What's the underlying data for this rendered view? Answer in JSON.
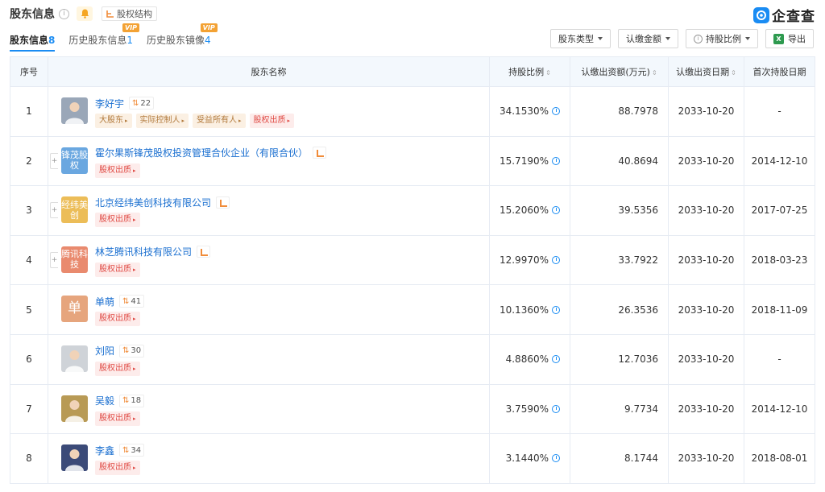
{
  "header": {
    "title": "股东信息",
    "info_glyph": "i",
    "structure_btn": "股权结构",
    "brand": "企查查"
  },
  "tabs": [
    {
      "label": "股东信息",
      "count": "8",
      "vip": ""
    },
    {
      "label": "历史股东信息",
      "count": "1",
      "vip": "VIP"
    },
    {
      "label": "历史股东镜像",
      "count": "4",
      "vip": "VIP"
    }
  ],
  "filters": {
    "type": "股东类型",
    "amount": "认缴金额",
    "ratio": "持股比例",
    "export": "导出",
    "info_glyph": "i",
    "excel_glyph": "X"
  },
  "columns": {
    "idx": "序号",
    "name": "股东名称",
    "ratio": "持股比例",
    "capital": "认缴出资额(万元)",
    "date": "认缴出资日期",
    "first_date": "首次持股日期",
    "sort_glyph": "⇕"
  },
  "glyphs": {
    "expand": "+",
    "related": "⇅",
    "tag_arrow": "▸"
  },
  "rows": [
    {
      "idx": "1",
      "name": "李好宇",
      "avatar_text": "",
      "avatar_color": "#9aa7b8",
      "count": "22",
      "tags": [
        [
          "大股东",
          "brown"
        ],
        [
          "实际控制人",
          "brown"
        ],
        [
          "受益所有人",
          "brown"
        ],
        [
          "股权出质",
          "red"
        ]
      ],
      "ratio": "34.1530%",
      "capital": "88.7978",
      "date": "2033-10-20",
      "first": "-"
    },
    {
      "idx": "2",
      "name": "霍尔果斯锋茂股权投资管理合伙企业（有限合伙）",
      "avatar_text": "锋茂股权",
      "avatar_color": "#6aa7e0",
      "count": "",
      "tags": [
        [
          "股权出质",
          "red"
        ]
      ],
      "ratio": "15.7190%",
      "capital": "40.8694",
      "date": "2033-10-20",
      "first": "2014-12-10"
    },
    {
      "idx": "3",
      "name": "北京经纬美创科技有限公司",
      "avatar_text": "经纬美创",
      "avatar_color": "#ecbd58",
      "count": "",
      "tags": [
        [
          "股权出质",
          "red"
        ]
      ],
      "ratio": "15.2060%",
      "capital": "39.5356",
      "date": "2033-10-20",
      "first": "2017-07-25"
    },
    {
      "idx": "4",
      "name": "林芝腾讯科技有限公司",
      "avatar_text": "腾讯科技",
      "avatar_color": "#e98a6e",
      "count": "",
      "tags": [
        [
          "股权出质",
          "red"
        ]
      ],
      "ratio": "12.9970%",
      "capital": "33.7922",
      "date": "2033-10-20",
      "first": "2018-03-23"
    },
    {
      "idx": "5",
      "name": "单萌",
      "avatar_text": "单",
      "avatar_color": "#e6a57d",
      "count": "41",
      "tags": [
        [
          "股权出质",
          "red"
        ]
      ],
      "ratio": "10.1360%",
      "capital": "26.3536",
      "date": "2033-10-20",
      "first": "2018-11-09"
    },
    {
      "idx": "6",
      "name": "刘阳",
      "avatar_text": "",
      "avatar_color": "#cfd3d8",
      "count": "30",
      "tags": [
        [
          "股权出质",
          "red"
        ]
      ],
      "ratio": "4.8860%",
      "capital": "12.7036",
      "date": "2033-10-20",
      "first": "-"
    },
    {
      "idx": "7",
      "name": "吴毅",
      "avatar_text": "",
      "avatar_color": "#b89a55",
      "count": "18",
      "tags": [
        [
          "股权出质",
          "red"
        ]
      ],
      "ratio": "3.7590%",
      "capital": "9.7734",
      "date": "2033-10-20",
      "first": "2014-12-10"
    },
    {
      "idx": "8",
      "name": "李鑫",
      "avatar_text": "",
      "avatar_color": "#3b4a78",
      "count": "34",
      "tags": [
        [
          "股权出质",
          "red"
        ]
      ],
      "ratio": "3.1440%",
      "capital": "8.1744",
      "date": "2033-10-20",
      "first": "2018-08-01"
    }
  ]
}
